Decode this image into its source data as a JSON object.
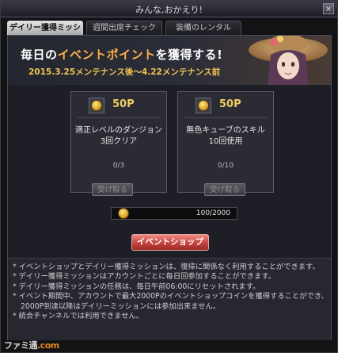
{
  "window": {
    "title": "みんな,おかえり!",
    "close_label": "×"
  },
  "tabs": [
    {
      "label": "デイリー獲得ミッション",
      "active": true
    },
    {
      "label": "週間出席チェック",
      "active": false
    },
    {
      "label": "装備のレンタル",
      "active": false
    }
  ],
  "banner": {
    "headline_pre": "毎日の",
    "headline_highlight": "イベントポイント",
    "headline_post": "を獲得する!",
    "subtitle": "2015.3.25メンテナンス後～4.22メンテナンス前"
  },
  "missions": [
    {
      "points": "50P",
      "desc_line1": "適正レベルのダンジョン",
      "desc_line2": "3回クリア",
      "progress": "0/3",
      "claim_label": "受け取る"
    },
    {
      "points": "50P",
      "desc_line1": "無色キューブのスキル",
      "desc_line2": "10回使用",
      "progress": "0/10",
      "claim_label": "受け取る"
    }
  ],
  "coin_counter": {
    "value": "100/2000"
  },
  "shop_button": {
    "label": "イベントショップ"
  },
  "notes": [
    "* イベントショップとデイリー獲得ミッションは、復帰に関係なく利用することができます。",
    "* デイリー獲得ミッションはアカウントごとに毎日回参加することができます。",
    "* デイリー獲得ミッションの任務は、毎日午前06:00にリセットされます。",
    "* イベント期間中、アカウントで最大2000Pのイベントショップコインを獲得することができ、2000P到達以降はデイリーミッションには参加出来ません。",
    "* 統合チャンネルでは利用できません。"
  ],
  "watermark": {
    "text_pre": "ファミ通",
    "text_o": ".com"
  },
  "colors": {
    "accent_orange": "#ffb14a",
    "subtitle_gold": "#f0c454",
    "shop_red": "#c4433e"
  },
  "icons": {
    "coin": "coin-icon",
    "portrait": "character-portrait"
  }
}
